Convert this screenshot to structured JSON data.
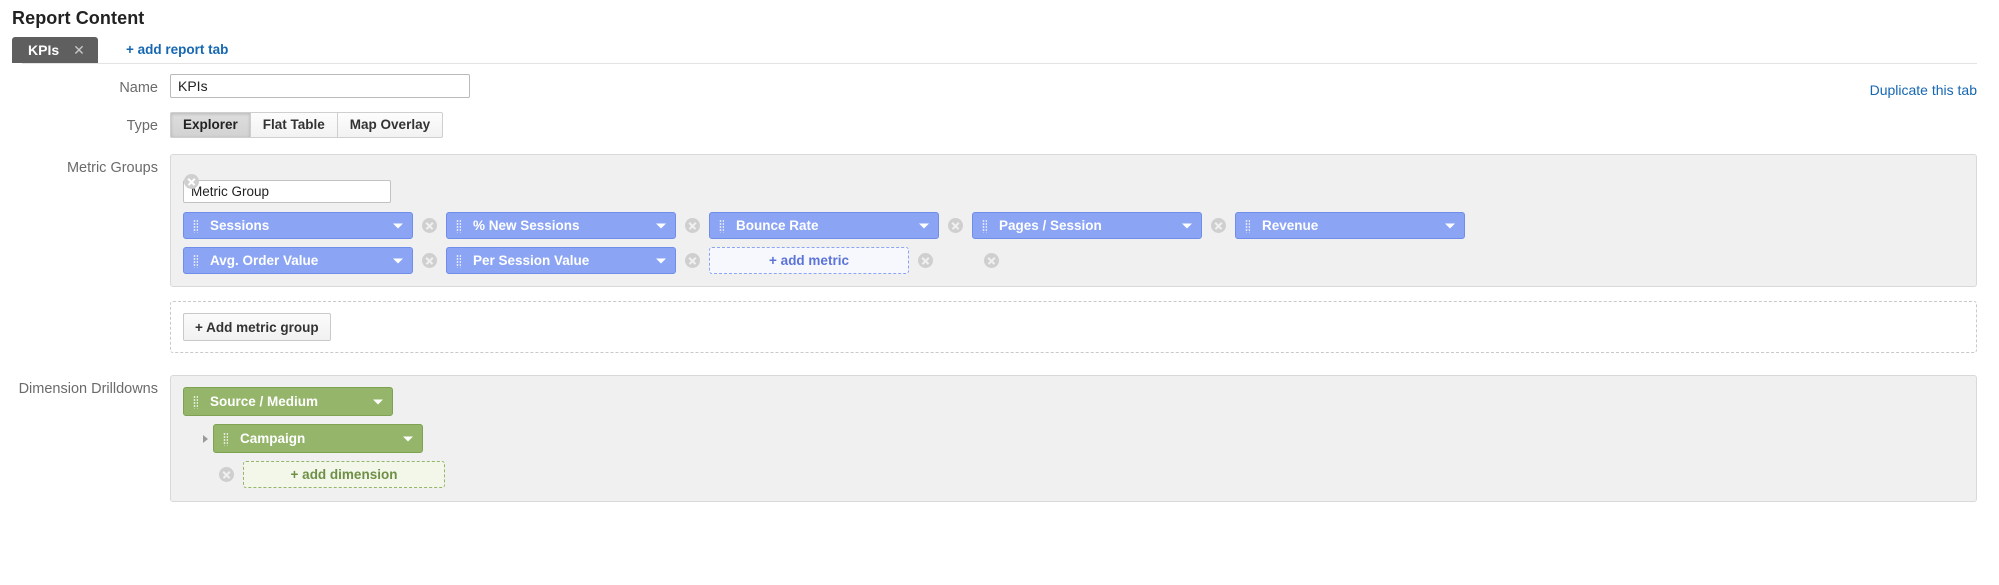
{
  "header": {
    "title": "Report Content"
  },
  "tabs": {
    "items": [
      {
        "label": "KPIs",
        "close_icon": "close-icon",
        "active": true
      }
    ],
    "add_tab_label": "+ add report tab"
  },
  "name_row": {
    "label": "Name",
    "value": "KPIs",
    "placeholder": "",
    "duplicate_link": "Duplicate this tab"
  },
  "type_row": {
    "label": "Type",
    "options": [
      {
        "label": "Explorer",
        "selected": true
      },
      {
        "label": "Flat Table",
        "selected": false
      },
      {
        "label": "Map Overlay",
        "selected": false
      }
    ]
  },
  "metric_groups": {
    "label": "Metric Groups",
    "group_name_value": "Metric Group",
    "group_name_placeholder": "Metric Group",
    "panel_remove_icon": "remove-icon",
    "rows": [
      {
        "pills": [
          {
            "label": "Sessions",
            "caret": "chevron-down-icon",
            "grip": "drag-handle-icon"
          },
          {
            "label": "% New Sessions",
            "caret": "chevron-down-icon",
            "grip": "drag-handle-icon"
          },
          {
            "label": "Bounce Rate",
            "caret": "chevron-down-icon",
            "grip": "drag-handle-icon"
          },
          {
            "label": "Pages / Session",
            "caret": "chevron-down-icon",
            "grip": "drag-handle-icon"
          },
          {
            "label": "Revenue",
            "caret": "chevron-down-icon",
            "grip": "drag-handle-icon"
          }
        ]
      },
      {
        "pills": [
          {
            "label": "Avg. Order Value",
            "caret": "chevron-down-icon",
            "grip": "drag-handle-icon"
          },
          {
            "label": "Per Session Value",
            "caret": "chevron-down-icon",
            "grip": "drag-handle-icon"
          }
        ],
        "add_metric_label": "+ add metric"
      }
    ],
    "add_group_label": "+ Add metric group"
  },
  "dimension_drilldowns": {
    "label": "Dimension Drilldowns",
    "pills": [
      {
        "label": "Source / Medium",
        "caret": "chevron-down-icon",
        "grip": "drag-handle-icon"
      },
      {
        "label": "Campaign",
        "caret": "chevron-down-icon",
        "grip": "drag-handle-icon"
      }
    ],
    "add_dimension_label": "+ add dimension"
  },
  "colors": {
    "metric_pill": "#8ba4f4",
    "dimension_pill": "#94b56a",
    "link": "#1667b1",
    "tab_active": "#5f5f5f",
    "panel_bg": "#f0f0f0"
  }
}
